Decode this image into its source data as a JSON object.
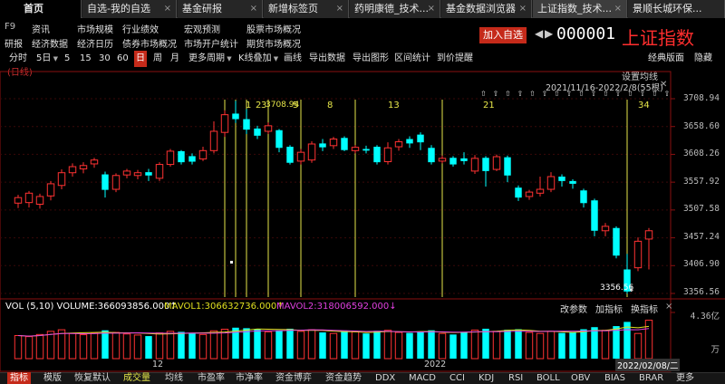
{
  "tabs": [
    {
      "label": "首页"
    },
    {
      "label": "自选-我的自选"
    },
    {
      "label": "基金研报"
    },
    {
      "label": "新增标签页"
    },
    {
      "label": "药明康德_技术..."
    },
    {
      "label": "基金数据浏览器"
    },
    {
      "label": "上证指数_技术..."
    },
    {
      "label": "景顺长城环保..."
    }
  ],
  "side": [
    "F9",
    "研报"
  ],
  "menu_row1": [
    "资讯",
    "市场规模",
    "行业绩效",
    "宏观预测",
    "股票市场概况"
  ],
  "menu_row2": [
    "经济数据",
    "经济日历",
    "债券市场概况",
    "市场开户统计",
    "期货市场概况"
  ],
  "add_watchlist": "加入自选",
  "stock_code": "000001",
  "stock_name": "上证指数",
  "toolbar": [
    "分时",
    "5日",
    "5",
    "15",
    "30",
    "60",
    "日",
    "周",
    "月",
    "更多周期",
    "K线叠加",
    "画线",
    "导出数据",
    "导出图形",
    "区间统计",
    "到价提醒"
  ],
  "toolbar_active": "日",
  "classic_layout": "经典版面",
  "hide": "隐藏",
  "chart_tag": "(日线)",
  "settings_ma": "设置均线",
  "date_range": "2021/11/16-2022/2/8(55根)",
  "low_label": "3356.56",
  "fib_labels": [
    "1",
    "2",
    "3",
    "5",
    "8",
    "13",
    "21",
    "34"
  ],
  "fib_extra": "3708.94",
  "vol_legend": {
    "vol": "VOL (5,10) VOLUME:366093856.000↑",
    "ma1": "MAVOL1:306632736.000↑",
    "ma2": "MAVOL2:318006592.000↓"
  },
  "vol_btns": [
    "改参数",
    "加指标",
    "换指标"
  ],
  "vol_axis": "4.36亿",
  "vol_unit": "万",
  "month_labels": [
    "12",
    "2022"
  ],
  "cursor_date": "2022/02/08/二",
  "bottom_tabs": [
    "指标",
    "模版",
    "恢复默认",
    "成交量",
    "均线",
    "市盈率",
    "市净率",
    "资金博弈",
    "资金趋势",
    "DDX",
    "MACD",
    "CCI",
    "KDJ",
    "RSI",
    "BOLL",
    "OBV",
    "BIAS",
    "BRAR",
    "更多"
  ],
  "bottom_active": "成交量",
  "colors": {
    "up": "#ff3232",
    "down": "#00ffff",
    "accent": "#c52a1a",
    "fib": "#e6e64a",
    "ma1": "#e0e020",
    "ma2": "#e040e0"
  },
  "chart_data": {
    "type": "candlestick",
    "y_ticks": [
      "3708.94",
      "3658.60",
      "3608.26",
      "3557.92",
      "3507.58",
      "3457.24",
      "3406.90",
      "3356.56"
    ],
    "ylim": [
      3356.56,
      3708.94
    ],
    "candles": [
      [
        3520,
        3530,
        3511,
        3535
      ],
      [
        3521,
        3538,
        3512,
        3542
      ],
      [
        3518,
        3532,
        3510,
        3537
      ],
      [
        3533,
        3555,
        3525,
        3560
      ],
      [
        3552,
        3575,
        3545,
        3581
      ],
      [
        3575,
        3586,
        3568,
        3592
      ],
      [
        3582,
        3588,
        3574,
        3594
      ],
      [
        3591,
        3598,
        3584,
        3602
      ],
      [
        3572,
        3544,
        3530,
        3577
      ],
      [
        3545,
        3570,
        3540,
        3574
      ],
      [
        3571,
        3578,
        3565,
        3582
      ],
      [
        3570,
        3575,
        3563,
        3580
      ],
      [
        3576,
        3570,
        3560,
        3582
      ],
      [
        3565,
        3590,
        3560,
        3594
      ],
      [
        3590,
        3614,
        3586,
        3618
      ],
      [
        3614,
        3594,
        3590,
        3616
      ],
      [
        3605,
        3595,
        3590,
        3610
      ],
      [
        3600,
        3615,
        3596,
        3622
      ],
      [
        3615,
        3650,
        3610,
        3668
      ],
      [
        3648,
        3680,
        3640,
        3688
      ],
      [
        3682,
        3672,
        3665,
        3705
      ],
      [
        3672,
        3653,
        3645,
        3690
      ],
      [
        3655,
        3642,
        3636,
        3660
      ],
      [
        3650,
        3660,
        3645,
        3666
      ],
      [
        3652,
        3620,
        3612,
        3654
      ],
      [
        3622,
        3593,
        3590,
        3625
      ],
      [
        3596,
        3612,
        3590,
        3618
      ],
      [
        3598,
        3627,
        3593,
        3632
      ],
      [
        3628,
        3621,
        3614,
        3636
      ],
      [
        3624,
        3636,
        3618,
        3640
      ],
      [
        3638,
        3616,
        3614,
        3641
      ],
      [
        3615,
        3621,
        3610,
        3625
      ],
      [
        3618,
        3615,
        3610,
        3624
      ],
      [
        3622,
        3594,
        3590,
        3625
      ],
      [
        3595,
        3620,
        3590,
        3630
      ],
      [
        3622,
        3631,
        3615,
        3636
      ],
      [
        3636,
        3628,
        3620,
        3641
      ],
      [
        3644,
        3630,
        3616,
        3648
      ],
      [
        3620,
        3594,
        3590,
        3625
      ],
      [
        3596,
        3601,
        3592,
        3606
      ],
      [
        3602,
        3590,
        3586,
        3605
      ],
      [
        3601,
        3596,
        3590,
        3612
      ],
      [
        3578,
        3601,
        3573,
        3607
      ],
      [
        3602,
        3578,
        3550,
        3605
      ],
      [
        3581,
        3604,
        3578,
        3608
      ],
      [
        3603,
        3570,
        3558,
        3606
      ],
      [
        3548,
        3530,
        3524,
        3552
      ],
      [
        3532,
        3540,
        3526,
        3544
      ],
      [
        3538,
        3545,
        3532,
        3568
      ],
      [
        3545,
        3568,
        3540,
        3576
      ],
      [
        3568,
        3560,
        3550,
        3572
      ],
      [
        3560,
        3555,
        3546,
        3563
      ],
      [
        3543,
        3520,
        3512,
        3546
      ],
      [
        3525,
        3470,
        3460,
        3528
      ],
      [
        3470,
        3478,
        3460,
        3484
      ],
      [
        3475,
        3425,
        3420,
        3478
      ],
      [
        3400,
        3360,
        3356,
        3428
      ],
      [
        3403,
        3451,
        3397,
        3458
      ],
      [
        3455,
        3470,
        3400,
        3475
      ]
    ],
    "volume": [
      220,
      210,
      230,
      260,
      275,
      240,
      228,
      245,
      270,
      250,
      235,
      225,
      215,
      245,
      260,
      255,
      240,
      230,
      265,
      280,
      295,
      290,
      280,
      255,
      270,
      285,
      260,
      275,
      250,
      240,
      262,
      255,
      240,
      265,
      270,
      250,
      245,
      260,
      270,
      240,
      230,
      255,
      272,
      285,
      260,
      275,
      280,
      250,
      240,
      260,
      245,
      255,
      280,
      300,
      270,
      310,
      350,
      240,
      366
    ]
  }
}
